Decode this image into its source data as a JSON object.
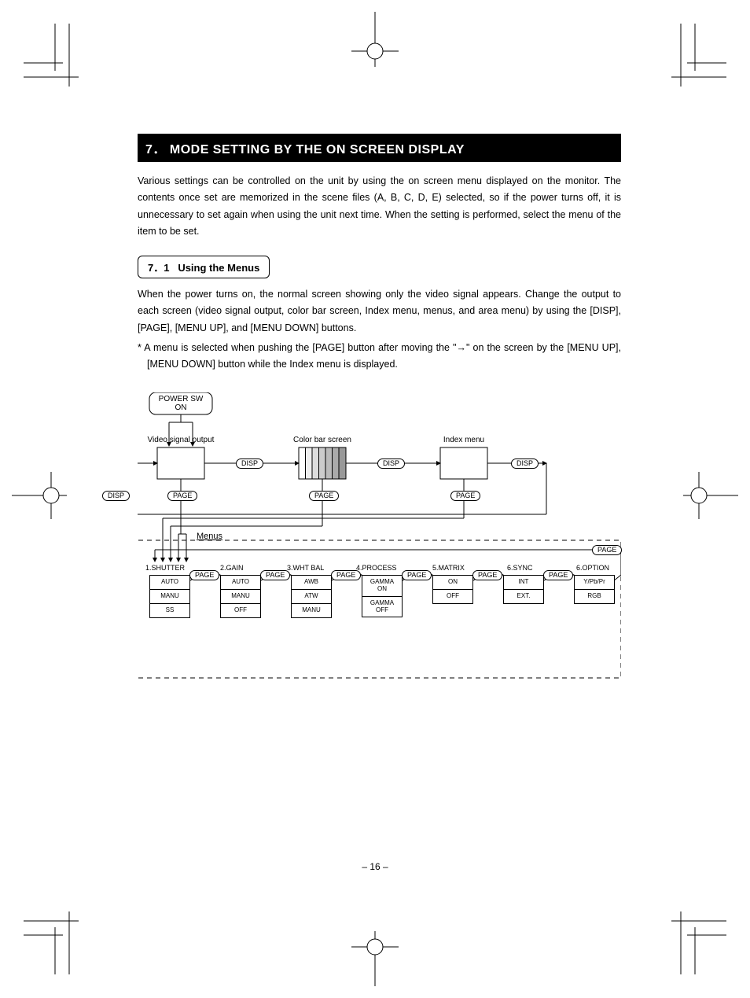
{
  "section_number": "7．",
  "section_title": "MODE SETTING BY THE ON SCREEN DISPLAY",
  "intro": "Various settings can be controlled on the unit by using the on screen menu displayed on the monitor. The contents once set are memorized in the scene files (A, B, C, D, E) selected, so if the power turns off, it is unnecessary to set again when using the unit next time. When the setting is performed, select the menu of the item to be set.",
  "sub_number": "7．1",
  "sub_title": "Using the Menus",
  "sub_para": "When the power turns on, the normal screen showing only the video signal appears. Change the output to each screen (video signal output, color bar screen, Index menu, menus, and area menu) by using the [DISP], [PAGE], [MENU UP], and [MENU DOWN] buttons.",
  "note": "* A menu is selected when pushing the [PAGE] button after moving the \"→\" on the screen by the [MENU UP], [MENU DOWN] button while the Index menu is displayed.",
  "diagram": {
    "power": "POWER SW\nON",
    "screens": [
      "Video signal output",
      "Color bar screen",
      "Index menu"
    ],
    "disp": "DISP",
    "page": "PAGE",
    "menus_label": "Menus",
    "menus": [
      {
        "title": "1.SHUTTER",
        "items": [
          "AUTO",
          "MANU",
          "SS"
        ]
      },
      {
        "title": "2.GAIN",
        "items": [
          "AUTO",
          "MANU",
          "OFF"
        ]
      },
      {
        "title": "3.WHT BAL",
        "items": [
          "AWB",
          "ATW",
          "MANU"
        ]
      },
      {
        "title": "4.PROCESS",
        "items": [
          "GAMMA\nON",
          "GAMMA\nOFF"
        ]
      },
      {
        "title": "5.MATRIX",
        "items": [
          "ON",
          "OFF"
        ]
      },
      {
        "title": "6.SYNC",
        "items": [
          "INT",
          "EXT."
        ]
      },
      {
        "title": "6.OPTION",
        "items": [
          "Y/Pb/Pr",
          "RGB"
        ]
      }
    ]
  },
  "page_number": "– 16 –"
}
